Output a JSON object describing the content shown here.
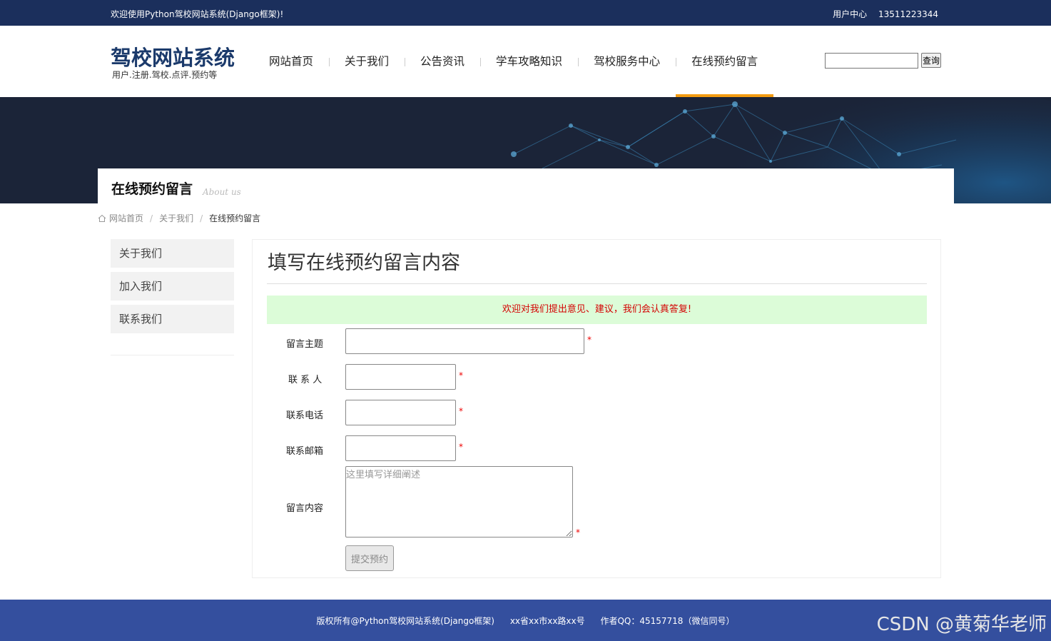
{
  "topbar": {
    "welcome": "欢迎使用Python驾校网站系统(Django框架)!",
    "user_center": "用户中心",
    "phone": "13511223344"
  },
  "header": {
    "logo_title": "驾校网站系统",
    "logo_subtitle": "用户.注册.驾校.点评.预约等",
    "nav": [
      {
        "label": "网站首页"
      },
      {
        "label": "关于我们"
      },
      {
        "label": "公告资讯"
      },
      {
        "label": "学车攻略知识"
      },
      {
        "label": "驾校服务中心"
      },
      {
        "label": "在线预约留言"
      }
    ],
    "search_button": "查询"
  },
  "banner": {
    "title": "在线预约留言",
    "subtitle": "About us"
  },
  "breadcrumb": {
    "home": "网站首页",
    "parent": "关于我们",
    "current": "在线预约留言"
  },
  "sidebar": {
    "items": [
      {
        "label": "关于我们"
      },
      {
        "label": "加入我们"
      },
      {
        "label": "联系我们"
      }
    ]
  },
  "main": {
    "title": "填写在线预约留言内容",
    "notice": "欢迎对我们提出意见、建议，我们会认真答复!",
    "form": {
      "subject_label": "留言主题",
      "contact_label": "联 系 人",
      "phone_label": "联系电话",
      "email_label": "联系邮箱",
      "content_label": "留言内容",
      "content_placeholder": "这里填写详细阐述",
      "required_mark": "*",
      "submit": "提交预约"
    }
  },
  "footer": {
    "copyright": "版权所有@Python驾校网站系统(Django框架)",
    "address": "xx省xx市xx路xx号",
    "author": "作者QQ：45157718（微信同号）",
    "watermark": "CSDN @黄菊华老师"
  },
  "colors": {
    "topbar": "#1b2f5c",
    "nav_active": "#f39c12",
    "footer": "#344f9e",
    "notice_bg": "#dcfcd8",
    "notice_text": "#d40000"
  }
}
